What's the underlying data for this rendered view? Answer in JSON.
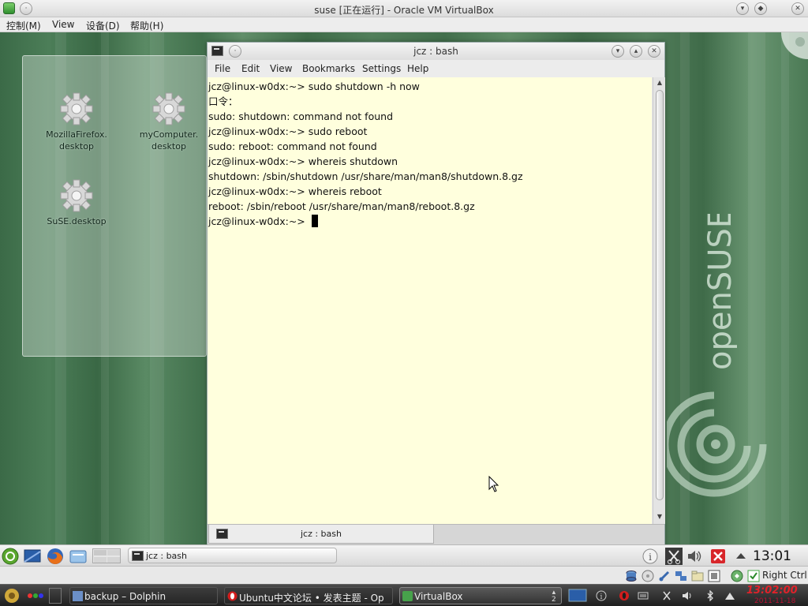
{
  "host": {
    "title": "suse [正在运行] - Oracle VM VirtualBox",
    "menu": [
      "控制(M)",
      "View",
      "设备(D)",
      "帮助(H)"
    ]
  },
  "desktop": {
    "icons": [
      {
        "label_line1": "MozillaFirefox.",
        "label_line2": "desktop"
      },
      {
        "label_line1": "myComputer.",
        "label_line2": "desktop"
      },
      {
        "label_line1": "SuSE.desktop",
        "label_line2": ""
      }
    ],
    "brand": "openSUSE"
  },
  "konsole": {
    "title": "jcz : bash",
    "menu": [
      "File",
      "Edit",
      "View",
      "Bookmarks",
      "Settings",
      "Help"
    ],
    "lines": [
      "jcz@linux-w0dx:~> sudo shutdown -h now",
      "口令：",
      "sudo: shutdown: command not found",
      "jcz@linux-w0dx:~> sudo reboot",
      "sudo: reboot: command not found",
      "jcz@linux-w0dx:~> whereis shutdown",
      "shutdown: /sbin/shutdown /usr/share/man/man8/shutdown.8.gz",
      "jcz@linux-w0dx:~> whereis reboot",
      "reboot: /sbin/reboot /usr/share/man/man8/reboot.8.gz",
      "jcz@linux-w0dx:~>  "
    ],
    "tab_label": "jcz : bash"
  },
  "panel": {
    "task_label": "jcz : bash",
    "clock": "13:01"
  },
  "vbox_status": {
    "host_key": "Right Ctrl"
  },
  "taskbar": {
    "tasks": [
      "backup – Dolphin",
      "Ubuntu中文论坛 • 发表主题 - Op",
      "VirtualBox"
    ],
    "clock": "13:02:00",
    "date": "2011-11-18",
    "desktop_number": "2"
  },
  "colors": {
    "terminal_bg": "#ffffdd",
    "clock_red": "#e0222a"
  }
}
